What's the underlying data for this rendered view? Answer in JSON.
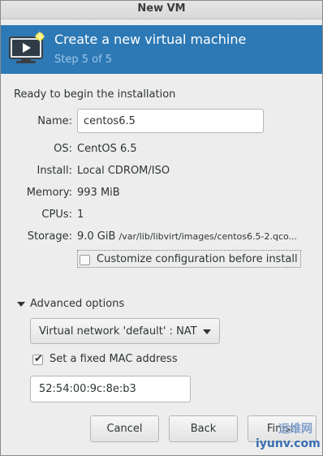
{
  "window": {
    "title": "New VM"
  },
  "header": {
    "title": "Create a new virtual machine",
    "subtitle": "Step 5 of 5",
    "icon": "vm-monitor-icon"
  },
  "summary": {
    "heading": "Ready to begin the installation",
    "name_label": "Name:",
    "name_value": "centos6.5",
    "os_label": "OS:",
    "os_value": "CentOS 6.5",
    "install_label": "Install:",
    "install_value": "Local CDROM/ISO",
    "memory_label": "Memory:",
    "memory_value": "993 MiB",
    "cpus_label": "CPUs:",
    "cpus_value": "1",
    "storage_label": "Storage:",
    "storage_value": "9.0 GiB",
    "storage_path": "/var/lib/libvirt/images/centos6.5-2.qco...",
    "customize_label": "Customize configuration before install",
    "customize_checked": false
  },
  "advanced": {
    "expander_label": "Advanced options",
    "expanded": true,
    "network_selected": "Virtual network 'default' : NAT",
    "mac_checkbox_label": "Set a fixed MAC address",
    "mac_checked": true,
    "mac_value": "52:54:00:9c:8e:b3"
  },
  "buttons": {
    "cancel": "Cancel",
    "back": "Back",
    "finish": "Finish"
  },
  "watermark": {
    "line1": "运维网",
    "line2": "iyunv.com"
  },
  "colors": {
    "header_bg": "#2d79b5",
    "header_subtitle": "#9fc6e9",
    "window_bg": "#ededed"
  }
}
